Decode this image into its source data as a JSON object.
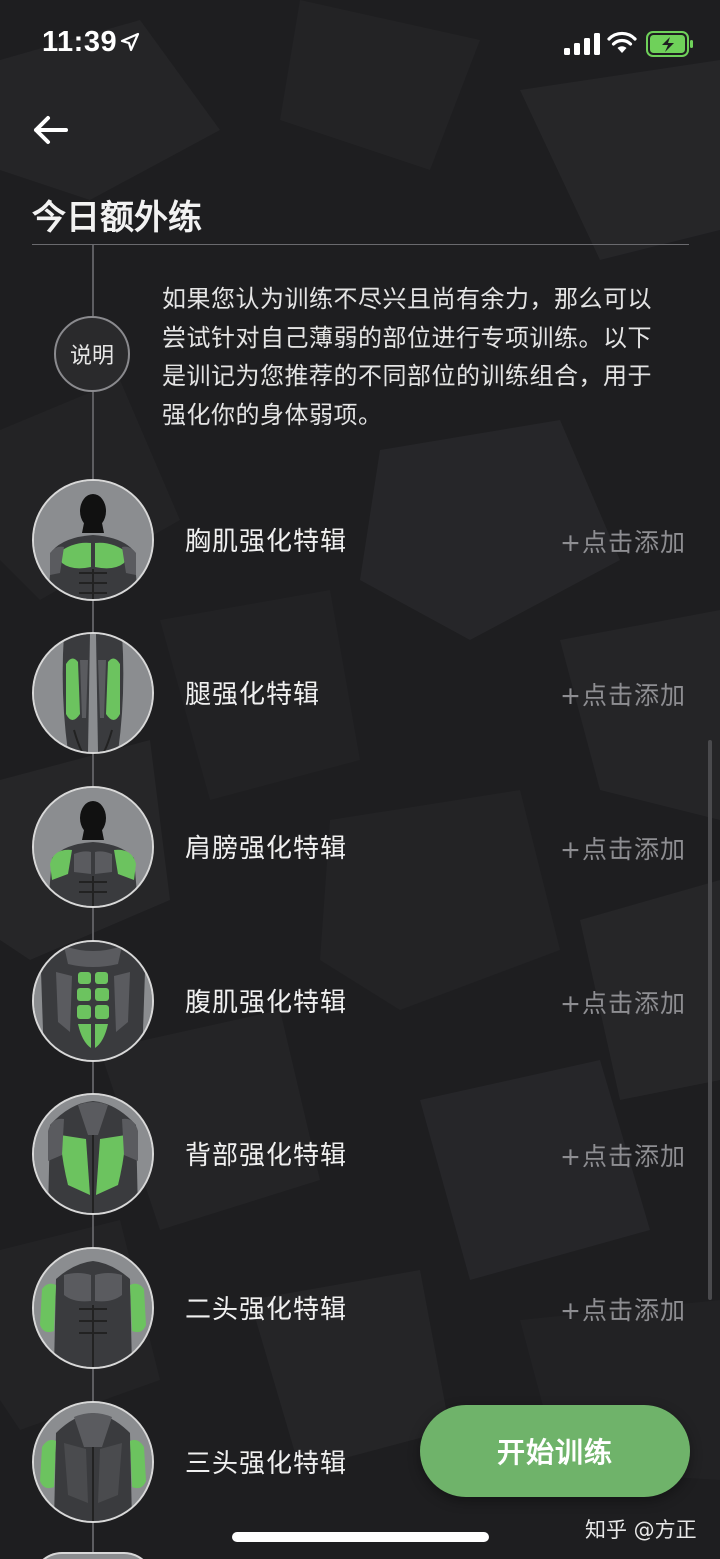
{
  "status_bar": {
    "time": "11:39"
  },
  "header": {
    "title": "今日额外练"
  },
  "note": {
    "badge": "说明",
    "text": "如果您认为训练不尽兴且尚有余力，那么可以尝试针对自己薄弱的部位进行专项训练。以下是训记为您推荐的不同部位的训练组合，用于强化你的身体弱项。"
  },
  "items": [
    {
      "title": "胸肌强化特辑",
      "action": "+点击添加",
      "icon": "chest-muscle-icon"
    },
    {
      "title": "腿强化特辑",
      "action": "+点击添加",
      "icon": "leg-muscle-icon"
    },
    {
      "title": "肩膀强化特辑",
      "action": "+点击添加",
      "icon": "shoulder-muscle-icon"
    },
    {
      "title": "腹肌强化特辑",
      "action": "+点击添加",
      "icon": "abs-muscle-icon"
    },
    {
      "title": "背部强化特辑",
      "action": "+点击添加",
      "icon": "back-muscle-icon"
    },
    {
      "title": "二头强化特辑",
      "action": "+点击添加",
      "icon": "biceps-muscle-icon"
    },
    {
      "title": "三头强化特辑",
      "action": "",
      "icon": "triceps-muscle-icon"
    }
  ],
  "start_button": "开始训练",
  "watermark": "知乎 @方正",
  "colors": {
    "accent_green": "#6fb36a",
    "muscle_highlight": "#6cc35f",
    "background": "#1e1e20"
  }
}
